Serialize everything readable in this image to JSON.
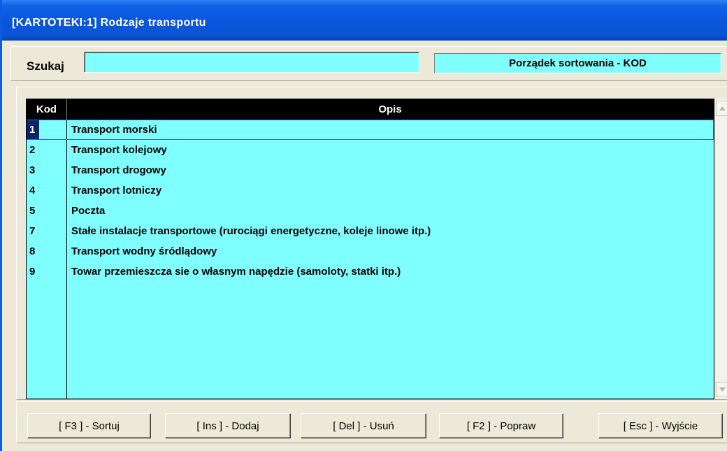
{
  "window": {
    "title": "[KARTOTEKI:1]  Rodzaje transportu"
  },
  "search": {
    "label": "Szukaj",
    "value": "",
    "sort_order": "Porządek sortowania - KOD"
  },
  "table": {
    "columns": [
      "Kod",
      "Opis"
    ],
    "rows": [
      {
        "kod": "1",
        "opis": "Transport morski"
      },
      {
        "kod": "2",
        "opis": "Transport kolejowy"
      },
      {
        "kod": "3",
        "opis": "Transport drogowy"
      },
      {
        "kod": "4",
        "opis": "Transport lotniczy"
      },
      {
        "kod": "5",
        "opis": "Poczta"
      },
      {
        "kod": "7",
        "opis": "Stałe instalacje transportowe (rurociągi energetyczne, koleje linowe itp.)"
      },
      {
        "kod": "8",
        "opis": "Transport wodny śródlądowy"
      },
      {
        "kod": "9",
        "opis": "Towar przemieszcza sie o własnym napędzie (samoloty, statki itp.)"
      }
    ],
    "selected_index": 0
  },
  "buttons": {
    "sort": "[ F3 ] - Sortuj",
    "add": "[ Ins ] - Dodaj",
    "delete": "[ Del ] - Usuń",
    "edit": "[ F2 ] - Popraw",
    "exit": "[ Esc ] - Wyjście"
  },
  "colors": {
    "title_bar": "#0a56dc",
    "field_background": "#80ffff",
    "header_background": "#000000",
    "selection": "#0a246a",
    "dialog_background": "#ece9d8"
  },
  "icons": {
    "scroll_up": "triangle-up-icon",
    "scroll_down": "triangle-down-icon"
  }
}
